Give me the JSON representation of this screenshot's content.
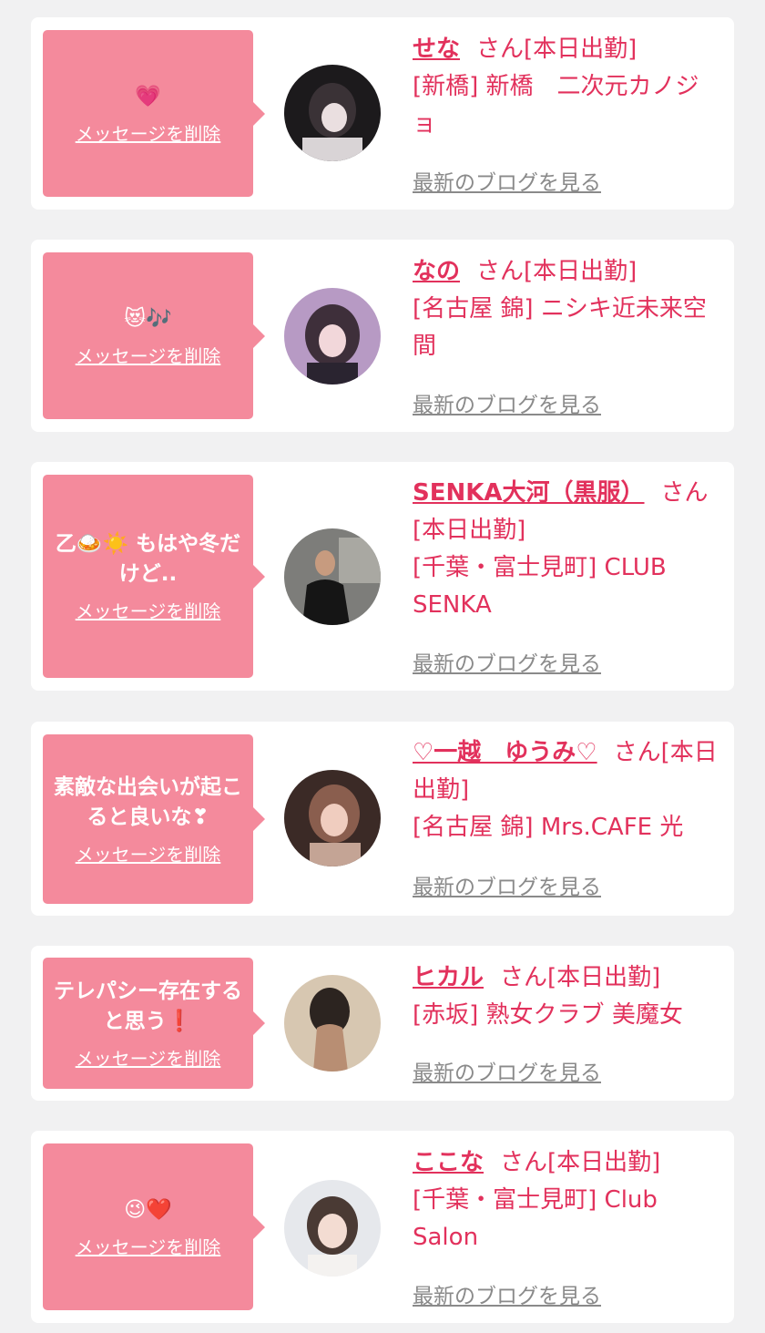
{
  "delete_label": "メッセージを削除",
  "blog_label": "最新のブログを見る",
  "san_suffix": "さん[本日出勤]",
  "entries": [
    {
      "message": "💗",
      "name": "せな",
      "shop": "[新橋] 新橋　二次元カノジョ"
    },
    {
      "message": "😻🎶",
      "name": "なの",
      "shop": "[名古屋 錦] ニシキ近未来空間"
    },
    {
      "message": "乙🍛☀️ もはや冬だけど..",
      "name": "SENKA大河（黒服）",
      "shop": "[千葉・富士見町] CLUB SENKA"
    },
    {
      "message": "素敵な出会いが起こると良いな❣",
      "name": "♡一越　ゆうみ♡",
      "shop": "[名古屋 錦] Mrs.CAFE 光"
    },
    {
      "message": "テレパシー存在すると思う❗",
      "name": "ヒカル",
      "shop": "[赤坂] 熟女クラブ 美魔女"
    },
    {
      "message": "😉❤️",
      "name": "ここな",
      "shop": "[千葉・富士見町] Club Salon"
    }
  ],
  "colors": {
    "bubble": "#f48a9c",
    "name_text": "#e2315c",
    "blog_link": "#8a8a8a",
    "background": "#f1f1f2"
  }
}
